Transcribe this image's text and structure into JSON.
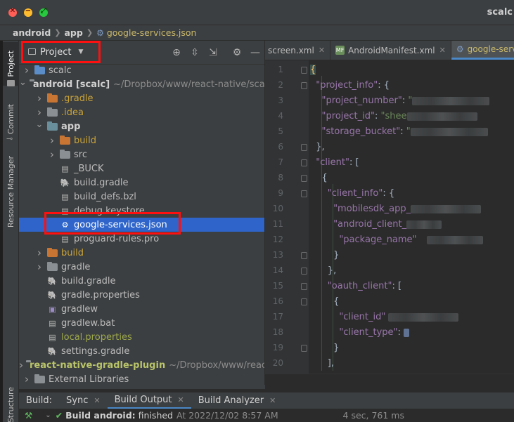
{
  "window": {
    "title": "scalc"
  },
  "breadcrumb": {
    "items": [
      "android",
      "app"
    ],
    "file": "google-services.json"
  },
  "left_strip": {
    "tabs": [
      "Project",
      "Commit",
      "Resource Manager",
      "Structure"
    ]
  },
  "project_panel": {
    "view_label": "Project",
    "tree": [
      {
        "label": "scalc",
        "indent": 0,
        "chevron": "›",
        "icon": "module",
        "style": "normal",
        "path": ""
      },
      {
        "label": "android [scalc]",
        "indent": 0,
        "chevron": "⌄",
        "icon": "folder-grey",
        "style": "bold",
        "path": "~/Dropbox/www/react-native/scalc"
      },
      {
        "label": ".gradle",
        "indent": 1,
        "chevron": "›",
        "icon": "folder-orange",
        "style": "orange",
        "path": ""
      },
      {
        "label": ".idea",
        "indent": 1,
        "chevron": "›",
        "icon": "folder-grey",
        "style": "orange",
        "path": ""
      },
      {
        "label": "app",
        "indent": 1,
        "chevron": "⌄",
        "icon": "folder-mod",
        "style": "bold",
        "path": ""
      },
      {
        "label": "build",
        "indent": 2,
        "chevron": "›",
        "icon": "folder-orange",
        "style": "orange",
        "path": ""
      },
      {
        "label": "src",
        "indent": 2,
        "chevron": "›",
        "icon": "folder-grey",
        "style": "normal",
        "path": ""
      },
      {
        "label": "_BUCK",
        "indent": 2,
        "chevron": "",
        "icon": "file",
        "style": "normal",
        "path": ""
      },
      {
        "label": "build.gradle",
        "indent": 2,
        "chevron": "",
        "icon": "gradle",
        "style": "normal",
        "path": ""
      },
      {
        "label": "build_defs.bzl",
        "indent": 2,
        "chevron": "",
        "icon": "file",
        "style": "normal",
        "path": ""
      },
      {
        "label": "debug.keystore",
        "indent": 2,
        "chevron": "",
        "icon": "file",
        "style": "normal",
        "path": ""
      },
      {
        "label": "google-services.json",
        "indent": 2,
        "chevron": "",
        "icon": "json",
        "style": "selected",
        "path": ""
      },
      {
        "label": "proguard-rules.pro",
        "indent": 2,
        "chevron": "",
        "icon": "file",
        "style": "normal",
        "path": ""
      },
      {
        "label": "build",
        "indent": 1,
        "chevron": "›",
        "icon": "folder-orange",
        "style": "orange",
        "path": ""
      },
      {
        "label": "gradle",
        "indent": 1,
        "chevron": "›",
        "icon": "folder-grey",
        "style": "normal",
        "path": ""
      },
      {
        "label": "build.gradle",
        "indent": 1,
        "chevron": "",
        "icon": "gradle",
        "style": "normal",
        "path": ""
      },
      {
        "label": "gradle.properties",
        "indent": 1,
        "chevron": "",
        "icon": "gradle",
        "style": "normal",
        "path": ""
      },
      {
        "label": "gradlew",
        "indent": 1,
        "chevron": "",
        "icon": "exec",
        "style": "normal",
        "path": ""
      },
      {
        "label": "gradlew.bat",
        "indent": 1,
        "chevron": "",
        "icon": "file",
        "style": "normal",
        "path": ""
      },
      {
        "label": "local.properties",
        "indent": 1,
        "chevron": "",
        "icon": "file",
        "style": "green",
        "path": ""
      },
      {
        "label": "settings.gradle",
        "indent": 1,
        "chevron": "",
        "icon": "gradle",
        "style": "normal",
        "path": ""
      },
      {
        "label": "react-native-gradle-plugin",
        "indent": 0,
        "chevron": "›",
        "icon": "folder-grey",
        "style": "bold-green",
        "path": "~/Dropbox/www/react-native"
      },
      {
        "label": "External Libraries",
        "indent": 0,
        "chevron": "›",
        "icon": "libs",
        "style": "normal",
        "path": ""
      }
    ]
  },
  "editor": {
    "tabs": [
      {
        "label": "screen.xml",
        "active": false,
        "icon": ""
      },
      {
        "label": "AndroidManifest.xml",
        "active": false,
        "icon": "MF"
      },
      {
        "label": "google-services",
        "active": true,
        "icon": "json"
      }
    ],
    "line_numbers": [
      "1",
      "2",
      "3",
      "4",
      "5",
      "6",
      "7",
      "8",
      "9",
      "10",
      "11",
      "12",
      "13",
      "14",
      "15",
      "16",
      "17",
      "18",
      "19",
      "20"
    ],
    "code": {
      "l1": "{",
      "l2_key": "\"project_info\"",
      "l3_key": "\"project_number\"",
      "l3_val": "\"",
      "l4_key": "\"project_id\"",
      "l4_val": "\"shee",
      "l5_key": "\"storage_bucket\"",
      "l5_val": "\"",
      "l6": "},",
      "l7_key": "\"client\"",
      "l8": "{",
      "l9_key": "\"client_info\"",
      "l10_key": "\"mobilesdk_app_",
      "l11_key": "\"android_client_",
      "l12_key": "\"package_name\"",
      "l13": "}",
      "l14": "},",
      "l15_key": "\"oauth_client\"",
      "l16": "{",
      "l17_key": "\"client_id\"",
      "l18_key": "\"client_type\"",
      "l18_val": "",
      "l19": "}",
      "l20": "],"
    }
  },
  "build_window": {
    "tabs": [
      "Build:",
      "Sync",
      "Build Output",
      "Build Analyzer"
    ],
    "active_tab": "Build Output",
    "status_bold": "Build android:",
    "status_text": "finished",
    "timestamp": "At 2022/12/02 8:57 AM",
    "duration": "4 sec, 761 ms"
  },
  "colors": {
    "selection": "#2f65ca",
    "highlight_box": "#ff1010",
    "accent_tab": "#4a88c7"
  }
}
